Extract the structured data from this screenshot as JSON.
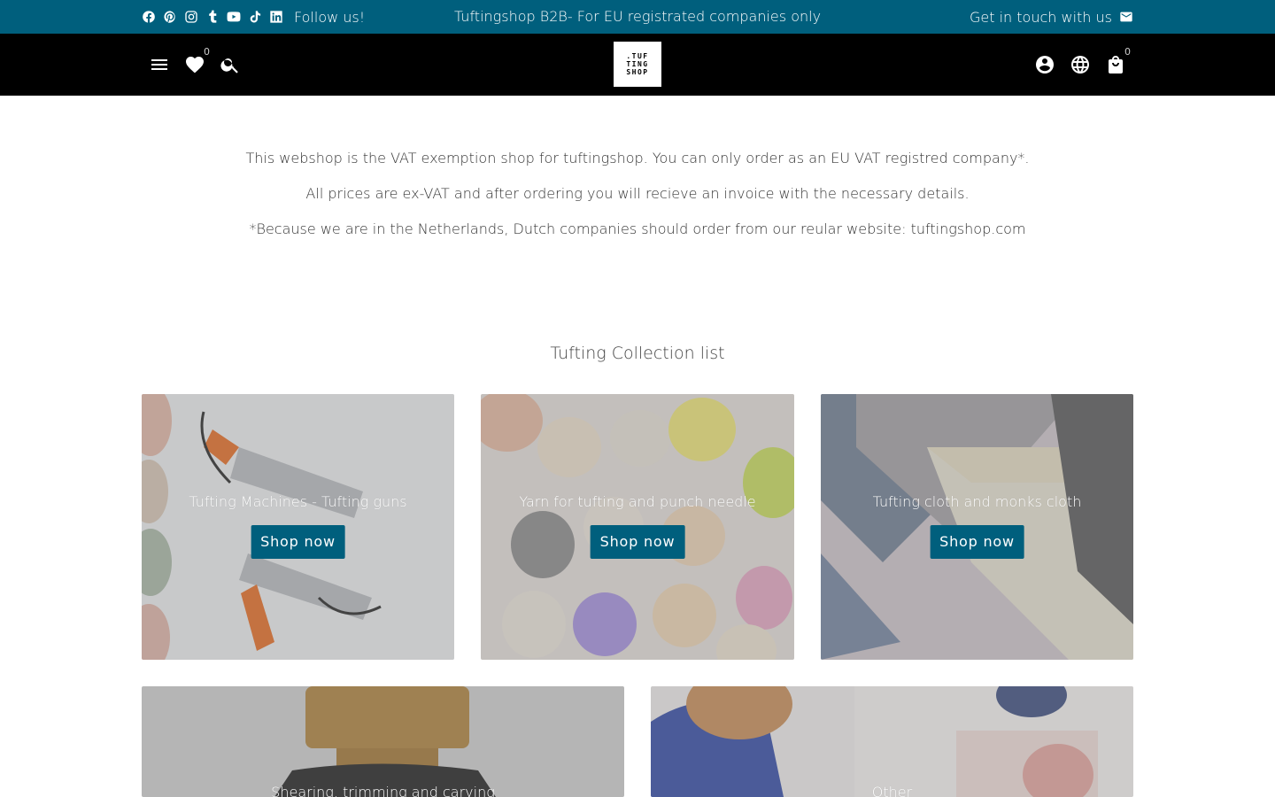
{
  "topbar": {
    "follow_label": "Follow us!",
    "center_message": "Tuftingshop B2B- For EU registrated companies only",
    "contact_label": "Get in touch with us",
    "social_icons": [
      "facebook-icon",
      "pinterest-icon",
      "instagram-icon",
      "tumblr-icon",
      "youtube-icon",
      "tiktok-icon",
      "linkedin-icon"
    ],
    "background_color": "#005f7d"
  },
  "header": {
    "wishlist_count": "0",
    "cart_count": "0",
    "logo_lines": [
      ".TUF",
      "TING",
      "SHOP"
    ],
    "background_color": "#000000"
  },
  "intro": {
    "line1": "This webshop is the VAT exemption shop for tuftingshop. You can only order as an EU VAT registred company*.",
    "line2": "All prices are ex-VAT and after ordering you will recieve an invoice with the necessary details.",
    "line3": "*Because we are in the Netherlands, Dutch companies should order from our reular website: tuftingshop.com"
  },
  "collections": {
    "title": "Tufting Collection list",
    "items": [
      {
        "label": "Tufting Machines - Tufting guns",
        "button": "Shop now"
      },
      {
        "label": "Yarn for tufting and punch needle",
        "button": "Shop now"
      },
      {
        "label": "Tufting cloth and monks cloth",
        "button": "Shop now"
      },
      {
        "label": "Shearing, trimming and carving"
      },
      {
        "label": "Other"
      }
    ],
    "button_color": "#005f7d"
  }
}
